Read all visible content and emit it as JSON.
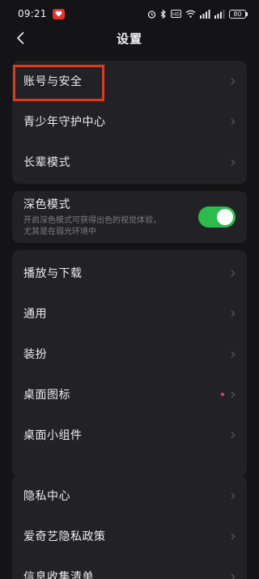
{
  "status_bar": {
    "time": "09:21",
    "battery": "80",
    "icons": [
      "app-notification-icon",
      "alarm-icon",
      "bluetooth-icon",
      "hd-icon",
      "wifi-icon",
      "signal-icon",
      "signal-icon",
      "battery-icon"
    ]
  },
  "header": {
    "title": "设置",
    "back_icon": "chevron-left-icon"
  },
  "groups": [
    {
      "items": [
        {
          "label": "账号与安全"
        },
        {
          "label": "青少年守护中心"
        },
        {
          "label": "长辈模式"
        }
      ]
    },
    {
      "dark_mode": {
        "title": "深色模式",
        "desc_line1": "开启深色模式可获得出色的视觉体验，",
        "desc_line2": "尤其是在弱光环境中",
        "enabled": true
      }
    },
    {
      "items": [
        {
          "label": "播放与下载"
        },
        {
          "label": "通用"
        },
        {
          "label": "装扮"
        },
        {
          "label": "桌面图标",
          "badge": "red-dot"
        },
        {
          "label": "桌面小组件"
        }
      ]
    },
    {
      "items": [
        {
          "label": "隐私中心"
        },
        {
          "label": "爱奇艺隐私政策"
        },
        {
          "label": "信息收集清单"
        }
      ]
    }
  ],
  "colors": {
    "background": "#141416",
    "card": "#222226",
    "toggle_on": "#2dbb4e",
    "highlight": "#e0381f",
    "badge": "#ff3366"
  }
}
